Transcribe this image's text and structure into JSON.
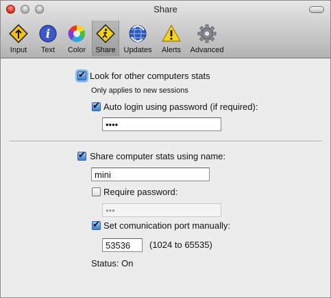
{
  "window": {
    "title": "Share"
  },
  "toolbar": {
    "items": [
      {
        "label": "Input",
        "icon": "road-sign-icon"
      },
      {
        "label": "Text",
        "icon": "info-icon"
      },
      {
        "label": "Color",
        "icon": "color-wheel-icon"
      },
      {
        "label": "Share",
        "icon": "pedestrian-sign-icon",
        "selected": true
      },
      {
        "label": "Updates",
        "icon": "globe-sync-icon"
      },
      {
        "label": "Alerts",
        "icon": "warning-icon"
      },
      {
        "label": "Advanced",
        "icon": "gear-icon"
      }
    ]
  },
  "look_for_computers": {
    "label": "Look for other computers stats",
    "checked": true,
    "note": "Only applies to new sessions"
  },
  "auto_login": {
    "label": "Auto login using password (if required):",
    "checked": true,
    "password_value": "••••"
  },
  "share_stats": {
    "label": "Share computer stats using name:",
    "checked": true,
    "name_value": "mini"
  },
  "require_password": {
    "label": "Require password:",
    "checked": false,
    "password_value": "•••"
  },
  "port": {
    "label": "Set comunication port manually:",
    "checked": true,
    "value": "53536",
    "range_note": "(1024 to 65535)"
  },
  "status": {
    "text": "Status: On"
  },
  "colors": {
    "accent": "#3b7fd4",
    "focus_ring": "#8db6ea"
  }
}
